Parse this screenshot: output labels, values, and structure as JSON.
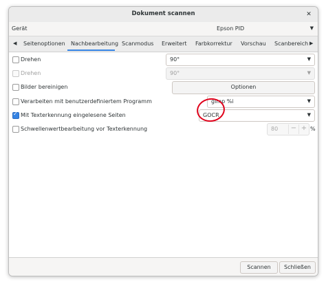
{
  "window": {
    "title": "Dokument scannen",
    "close_glyph": "✕"
  },
  "device": {
    "label": "Gerät",
    "value": "Epson PID"
  },
  "tabs": {
    "prev_glyph": "◀",
    "next_glyph": "▶",
    "items": [
      {
        "label": "Seitenoptionen"
      },
      {
        "label": "Nachbearbeitung"
      },
      {
        "label": "Scanmodus"
      },
      {
        "label": "Erweitert"
      },
      {
        "label": "Farbkorrektur"
      },
      {
        "label": "Vorschau"
      },
      {
        "label": "Scanbereich"
      }
    ],
    "active": "Nachbearbeitung"
  },
  "options": {
    "rotate": {
      "label": "Drehen",
      "checked": false,
      "value": "90°"
    },
    "rotate2": {
      "label": "Drehen",
      "checked": false,
      "disabled": true,
      "value": "90°"
    },
    "clean": {
      "label": "Bilder bereinigen",
      "checked": false,
      "button": "Optionen"
    },
    "custom": {
      "label": "Verarbeiten mit benutzerdefiniertem Programm",
      "checked": false,
      "value": "gimp %i"
    },
    "ocr": {
      "label": "Mit Texterkennung eingelesene Seiten",
      "checked": true,
      "value": "GOCR"
    },
    "threshold": {
      "label": "Schwellenwertbearbeitung vor Texterkennung",
      "checked": false,
      "value": "80",
      "minus": "−",
      "plus": "+",
      "unit": "%"
    }
  },
  "dropdown_glyph": "▼",
  "footer": {
    "scan": "Scannen",
    "close": "Schließen"
  },
  "colors": {
    "accent": "#3584e4",
    "annotation": "#e0001a"
  }
}
